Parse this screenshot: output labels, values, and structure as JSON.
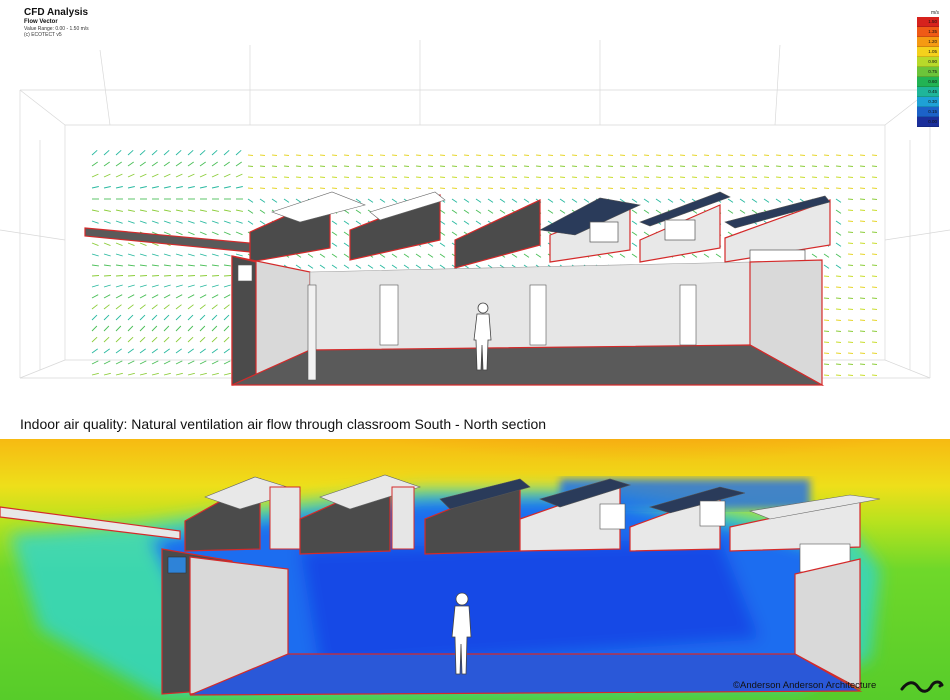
{
  "cfd_header": {
    "title": "CFD Analysis",
    "subtitle": "Flow Vector",
    "value_range": "Value Range: 0.00 - 1.50 m/s",
    "credit": "(c) ECOTECT v5"
  },
  "legend": {
    "unit": "m/s",
    "entries": [
      {
        "label": "1.50",
        "color": "#d6221d"
      },
      {
        "label": "1.35",
        "color": "#ef5a16"
      },
      {
        "label": "1.20",
        "color": "#f59a12"
      },
      {
        "label": "1.05",
        "color": "#f4d11c"
      },
      {
        "label": "0.90",
        "color": "#b8d92a"
      },
      {
        "label": "0.75",
        "color": "#6cc43a"
      },
      {
        "label": "0.60",
        "color": "#22b354"
      },
      {
        "label": "0.45",
        "color": "#1fb59a"
      },
      {
        "label": "0.30",
        "color": "#1ea1d6"
      },
      {
        "label": "0.15",
        "color": "#1c62c8"
      },
      {
        "label": "0.00",
        "color": "#1b2f9b"
      }
    ]
  },
  "caption": "Indoor air quality: Natural ventilation air flow through classroom South - North section",
  "copyright": "©Anderson Anderson Architecture",
  "colors": {
    "outline": "#d42a2a",
    "wall_dark": "#4b4b4b",
    "wall_light": "#d9d9d9",
    "floor": "#5a5a5a"
  }
}
